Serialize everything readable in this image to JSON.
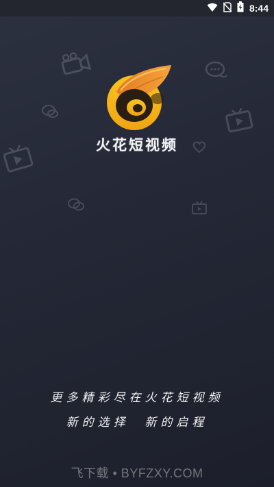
{
  "status_bar": {
    "time": "8:44",
    "icons": [
      "wifi-icon",
      "no-sim-icon",
      "battery-charging-icon"
    ]
  },
  "splash": {
    "app_name": "火花短视频",
    "slogan_line1": "更多精彩尽在火花短视频",
    "slogan_line2": "新的选择  新的启程",
    "logo_icon": "flame-eye-logo-icon",
    "decorative_icons": [
      "video-camera-icon",
      "chat-bubble-icon",
      "tv-play-icon",
      "heart-bubble-icon"
    ]
  },
  "watermark": {
    "text": "飞下载 • BYFZXY.COM"
  },
  "colors": {
    "background_top": "#2c3140",
    "background_bottom": "#1c1f2b",
    "logo_orange": "#f29a2e",
    "logo_yellow": "#f7c21b",
    "logo_dark": "#2a1e12"
  }
}
